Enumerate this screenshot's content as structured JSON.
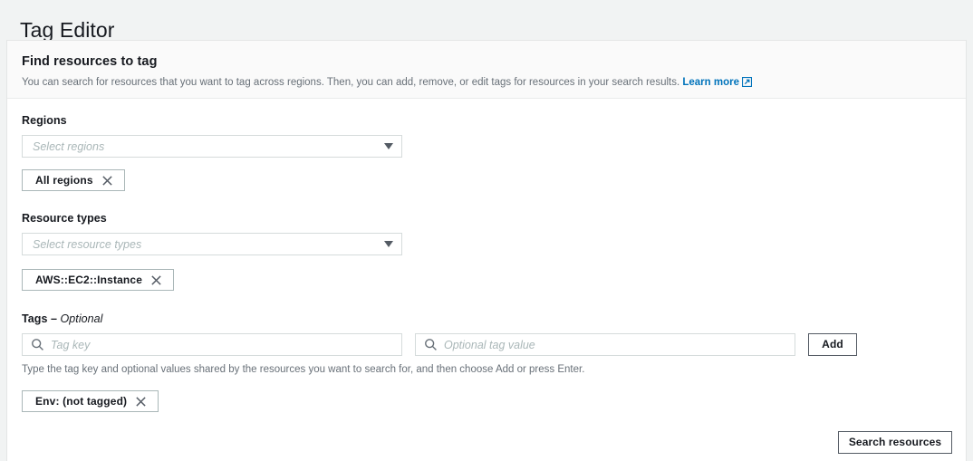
{
  "page": {
    "title": "Tag Editor"
  },
  "panel": {
    "header_title": "Find resources to tag",
    "description_prefix": "You can search for resources that you want to tag across regions. Then, you can add, remove, or edit tags for resources in your search results. ",
    "learn_more_label": "Learn more",
    "learn_more_icon": "external-link-icon"
  },
  "regions": {
    "label": "Regions",
    "placeholder": "Select regions",
    "caret_icon": "chevron-down-icon",
    "tokens": [
      {
        "label": "All regions",
        "dismiss_icon": "close-icon"
      }
    ]
  },
  "resource_types": {
    "label": "Resource types",
    "placeholder": "Select resource types",
    "caret_icon": "chevron-down-icon",
    "tokens": [
      {
        "label": "AWS::EC2::Instance",
        "dismiss_icon": "close-icon"
      }
    ]
  },
  "tags": {
    "label": "Tags",
    "label_separator": " – ",
    "optional_label": "Optional",
    "key_icon": "search-icon",
    "key_placeholder": "Tag key",
    "value_icon": "search-icon",
    "value_placeholder": "Optional tag value",
    "add_label": "Add",
    "hint": "Type the tag key and optional values shared by the resources you want to search for, and then choose Add or press Enter.",
    "tokens": [
      {
        "label": "Env: (not tagged)",
        "dismiss_icon": "close-icon"
      }
    ]
  },
  "footer": {
    "search_label": "Search resources"
  },
  "colors": {
    "link": "#0073bb",
    "page_background": "#f1f3f3",
    "panel_background": "#ffffff",
    "panel_header_background": "#fafafa",
    "border": "#d5dbdb",
    "text": "#16191f",
    "muted_text": "#687078",
    "placeholder": "#aab7b8"
  }
}
